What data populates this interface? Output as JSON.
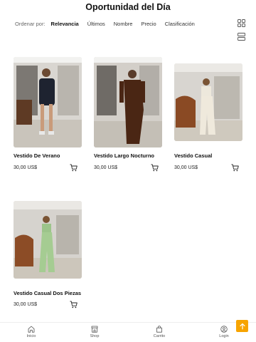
{
  "header": {
    "title": "Oportunidad del Día"
  },
  "sort": {
    "label": "Ordenar por:",
    "options": [
      "Relevancia",
      "Últimos",
      "Nombre",
      "Precio",
      "Clasificación"
    ],
    "active_index": 0
  },
  "view_toggles": [
    {
      "icon": "grid-icon"
    },
    {
      "icon": "list-icon"
    }
  ],
  "products": [
    {
      "name": "Vestido De Verano",
      "price": "30,00 US$",
      "icon": "cart-icon"
    },
    {
      "name": "Vestido Largo Nocturno",
      "price": "30,00 US$",
      "icon": "cart-icon"
    },
    {
      "name": "Vestido Casual",
      "price": "30,00 US$",
      "icon": "cart-icon"
    },
    {
      "name": "Vestido Casual Dos Piezas",
      "price": "30,00 US$",
      "icon": "cart-icon"
    }
  ],
  "bottom_nav": {
    "items": [
      {
        "label": "Inicio",
        "icon": "home-icon"
      },
      {
        "label": "Shop",
        "icon": "shop-icon"
      },
      {
        "label": "Carrito",
        "icon": "bag-icon"
      },
      {
        "label": "Login",
        "icon": "user-icon"
      }
    ]
  },
  "colors": {
    "accent": "#f7a400"
  }
}
